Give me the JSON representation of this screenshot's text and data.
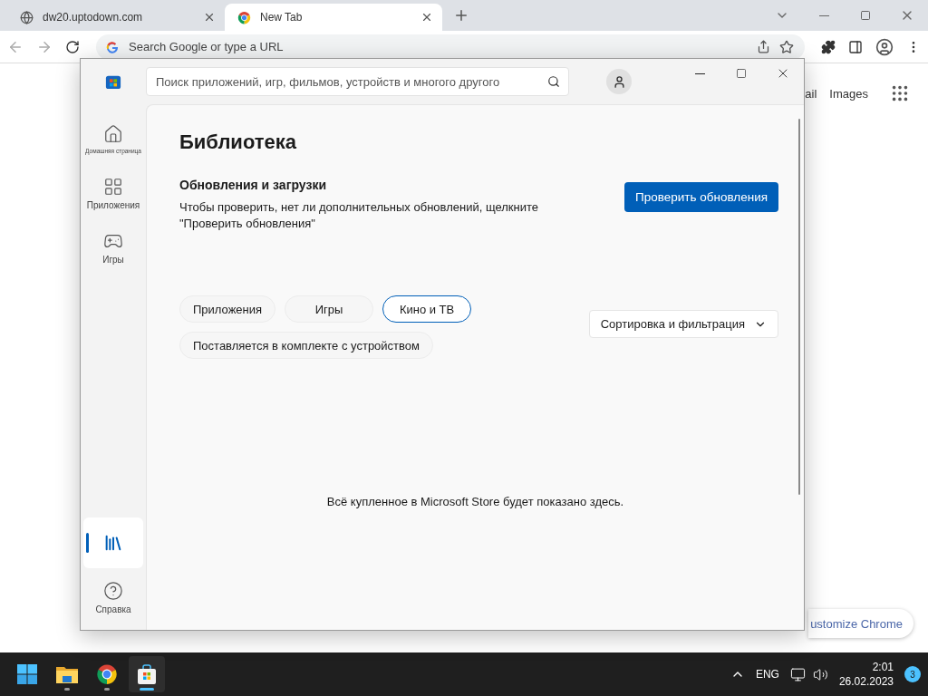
{
  "browser": {
    "tabs": [
      {
        "title": "dw20.uptodown.com",
        "kind": "site",
        "selected": false
      },
      {
        "title": "New Tab",
        "kind": "chrome",
        "selected": true
      }
    ],
    "address_placeholder": "Search Google or type a URL",
    "header_links": [
      "ail",
      "Images"
    ],
    "customize_button": "ustomize Chrome"
  },
  "store": {
    "search_placeholder": "Поиск приложений, игр, фильмов, устройств и многого другого",
    "nav": [
      {
        "label": "Домашняя страница",
        "kind": "home",
        "selected": false
      },
      {
        "label": "Приложения",
        "kind": "apps",
        "selected": false
      },
      {
        "label": "Игры",
        "kind": "games",
        "selected": false
      },
      {
        "kind": "library",
        "selected": true
      },
      {
        "label": "Справка",
        "kind": "help",
        "selected": false
      }
    ],
    "title": "Библиотека",
    "section_title": "Обновления и загрузки",
    "section_text": "Чтобы проверить, нет ли дополнительных обновлений, щелкните \"Проверить обновления\"",
    "check_button": "Проверить обновления",
    "filters": [
      {
        "label": "Приложения",
        "selected": false
      },
      {
        "label": "Игры",
        "selected": false
      },
      {
        "label": "Кино и ТВ",
        "selected": true
      },
      {
        "label": "Поставляется в комплекте с устройством",
        "selected": false
      }
    ],
    "sort_button": "Сортировка и фильтрация",
    "empty_message": "Всё купленное в Microsoft Store будет показано здесь."
  },
  "taskbar": {
    "apps": [
      {
        "kind": "start",
        "running": false,
        "selected": false
      },
      {
        "kind": "explorer",
        "running": true,
        "selected": false
      },
      {
        "kind": "chrome",
        "running": true,
        "selected": false
      },
      {
        "kind": "store",
        "running": true,
        "selected": true
      }
    ],
    "language": "ENG",
    "time": "2:01",
    "date": "26.02.2023",
    "notification_count": "3"
  }
}
